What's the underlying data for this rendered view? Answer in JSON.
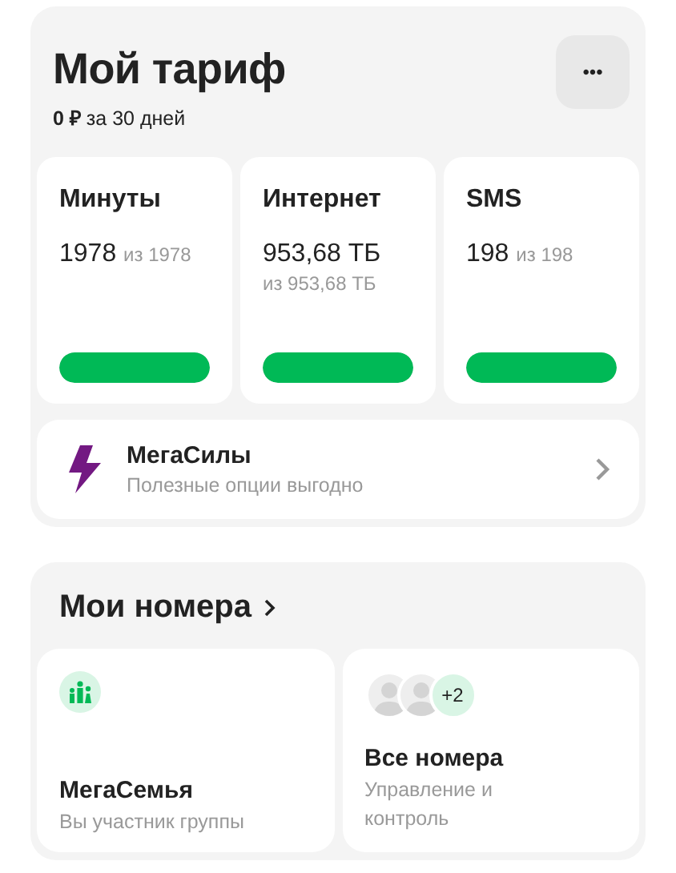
{
  "tariff": {
    "title": "Мой тариф",
    "price": "0 ₽",
    "period": "за 30 дней",
    "menu_button": "•••",
    "counters": [
      {
        "name": "Минуты",
        "value": "1978",
        "total": "из 1978",
        "level": 1
      },
      {
        "name": "Интернет",
        "value": "953,68 ТБ",
        "total": "из 953,68 ТБ",
        "level": 1
      },
      {
        "name": "SMS",
        "value": "198",
        "total": "из 198",
        "level": 1
      }
    ],
    "promo": {
      "title": "МегаСилы",
      "subtitle": "Полезные опции выгодно"
    }
  },
  "numbers": {
    "title": "Мои номера",
    "cards": [
      {
        "kind": "family",
        "title": "МегаСемья",
        "subtitle": "Вы участник группы"
      },
      {
        "kind": "all",
        "title": "Все номера",
        "subtitle": "Управление и контроль",
        "extra_count": "+2"
      }
    ]
  }
}
